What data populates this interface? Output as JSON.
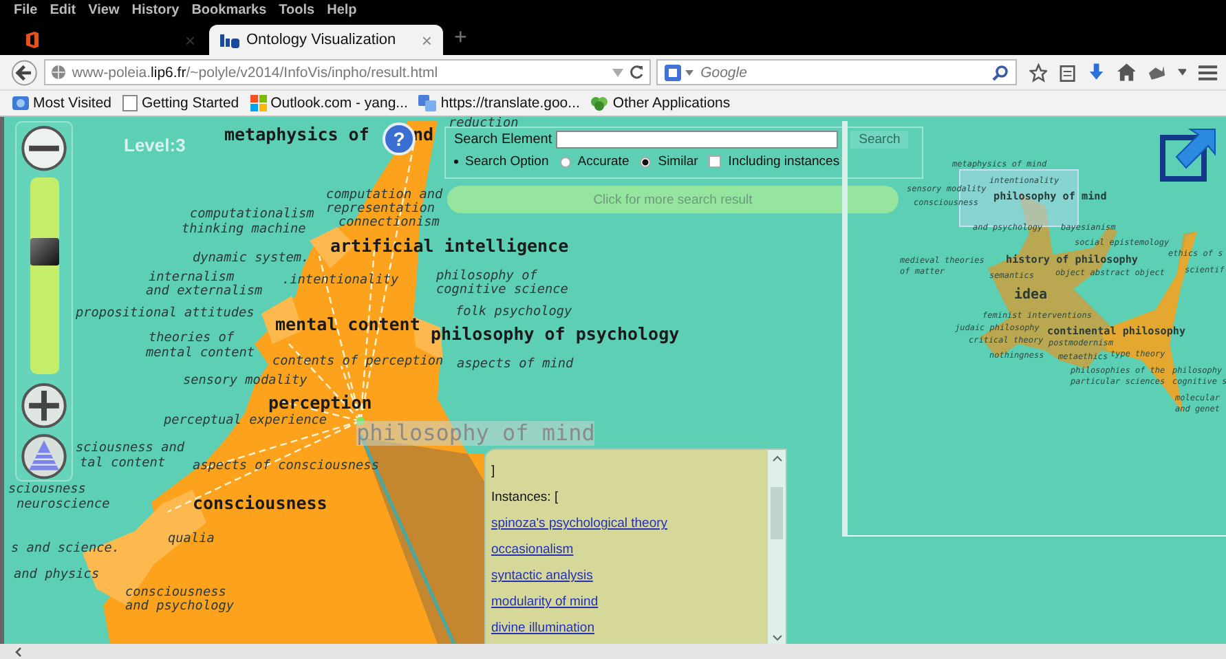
{
  "menu_bar": [
    "File",
    "Edit",
    "View",
    "History",
    "Bookmarks",
    "Tools",
    "Help"
  ],
  "tabs": [
    {
      "kind": "icon",
      "close": "×",
      "selected": false
    },
    {
      "kind": "page",
      "label": "Ontology Visualization",
      "close": "×",
      "selected": true
    }
  ],
  "new_tab": "+",
  "address_bar": {
    "url": "www-poleia.**lip6.fr**/~polyle/v2014/InfoVis/inpho/result.html"
  },
  "search_bar": {
    "placeholder": "Google"
  },
  "bookmarks": [
    {
      "label": "Most Visited",
      "kind": "globe"
    },
    {
      "label": "Getting Started",
      "kind": "page"
    },
    {
      "label": "Outlook.com - yang...",
      "kind": "tiles"
    },
    {
      "label": "https://translate.goo...",
      "kind": "translate"
    },
    {
      "label": "Other Applications",
      "kind": "leaf"
    }
  ],
  "visualization": {
    "level": "Level:3",
    "help_button": "?",
    "zoom_slider": {
      "level": 0.64
    },
    "labels": [
      {
        "text": "metaphysics of",
        "kind": "major"
      },
      {
        "text": "nd",
        "kind": "major"
      },
      {
        "text": "reduction",
        "kind": "minor"
      },
      {
        "text": "computation and",
        "kind": "minor"
      },
      {
        "text": "representation",
        "kind": "minor"
      },
      {
        "text": "connectionism",
        "kind": "minor"
      },
      {
        "text": "computationalism",
        "kind": "minor"
      },
      {
        "text": "thinking machine",
        "kind": "minor"
      },
      {
        "text": "artificial intelligence",
        "kind": "major"
      },
      {
        "text": "dynamic system.",
        "kind": "minor"
      },
      {
        "text": "internalism",
        "kind": "minor"
      },
      {
        "text": "and externalism",
        "kind": "minor"
      },
      {
        "text": ".intentionality",
        "kind": "minor"
      },
      {
        "text": "philosophy of",
        "kind": "minor"
      },
      {
        "text": "cognitive science",
        "kind": "minor"
      },
      {
        "text": "propositional attitudes",
        "kind": "minor"
      },
      {
        "text": "folk psychology",
        "kind": "minor"
      },
      {
        "text": "mental content",
        "kind": "major"
      },
      {
        "text": "theories of",
        "kind": "minor"
      },
      {
        "text": "philosophy of psychology",
        "kind": "major"
      },
      {
        "text": "mental content",
        "kind": "minor"
      },
      {
        "text": "contents of perception",
        "kind": "minor"
      },
      {
        "text": "aspects of mind",
        "kind": "minor"
      },
      {
        "text": "sensory modality",
        "kind": "minor"
      },
      {
        "text": "perception",
        "kind": "major"
      },
      {
        "text": "perceptual experience",
        "kind": "minor"
      },
      {
        "text": "philosophy of mind",
        "kind": "focus"
      },
      {
        "text": "sciousness and",
        "kind": "minor"
      },
      {
        "text": "tal content",
        "kind": "minor"
      },
      {
        "text": "aspects of consciousness",
        "kind": "minor"
      },
      {
        "text": "sciousness",
        "kind": "minor"
      },
      {
        "text": "neuroscience",
        "kind": "minor"
      },
      {
        "text": "consciousness",
        "kind": "major"
      },
      {
        "text": "qualia",
        "kind": "minor"
      },
      {
        "text": "s and science.",
        "kind": "minor"
      },
      {
        "text": "and physics",
        "kind": "minor"
      },
      {
        "text": "consciousness",
        "kind": "minor"
      },
      {
        "text": "and psychology",
        "kind": "minor"
      }
    ]
  },
  "search_panel": {
    "label": "Search Element",
    "button": "Search",
    "option_label": "Search Option",
    "options": [
      {
        "label": "Accurate",
        "selected": false
      },
      {
        "label": "Similar",
        "selected": true
      }
    ],
    "include_instances": {
      "label": "Including instances",
      "checked": false
    },
    "more_results": "Click for more search result"
  },
  "instances_popup": {
    "lines": [
      "]",
      "Instances: ["
    ],
    "links": [
      "spinoza's psychological theory",
      "occasionalism",
      "syntactic analysis",
      "modularity of mind",
      "divine illumination"
    ]
  },
  "minimap": {
    "labels": [
      {
        "text": "metaphysics of mind",
        "kind": "minor"
      },
      {
        "text": "intentionality",
        "kind": "minor"
      },
      {
        "text": "sensory modality",
        "kind": "minor"
      },
      {
        "text": "philosophy of mind",
        "kind": "major"
      },
      {
        "text": "consciousness",
        "kind": "minor"
      },
      {
        "text": "and psychology",
        "kind": "minor"
      },
      {
        "text": "bayesianism",
        "kind": "minor"
      },
      {
        "text": "social epistemology",
        "kind": "minor"
      },
      {
        "text": "ethics of s",
        "kind": "minor"
      },
      {
        "text": "medieval theories",
        "kind": "minor"
      },
      {
        "text": "of matter",
        "kind": "minor"
      },
      {
        "text": "history of philosophy",
        "kind": "major"
      },
      {
        "text": "semantics",
        "kind": "minor"
      },
      {
        "text": "object abstract object",
        "kind": "minor"
      },
      {
        "text": "scientif",
        "kind": "minor"
      },
      {
        "text": "idea",
        "kind": "large"
      },
      {
        "text": "feminist interventions",
        "kind": "minor"
      },
      {
        "text": "judaic philosophy",
        "kind": "minor"
      },
      {
        "text": "continental philosophy",
        "kind": "major"
      },
      {
        "text": "critical theory",
        "kind": "minor"
      },
      {
        "text": "postmodernism",
        "kind": "minor"
      },
      {
        "text": "nothingness",
        "kind": "minor"
      },
      {
        "text": "metaethics",
        "kind": "minor"
      },
      {
        "text": "type theory",
        "kind": "minor"
      },
      {
        "text": "philosophies of the",
        "kind": "minor"
      },
      {
        "text": "particular sciences",
        "kind": "minor"
      },
      {
        "text": "philosophy",
        "kind": "minor"
      },
      {
        "text": "cognitive s",
        "kind": "minor"
      },
      {
        "text": "molecular",
        "kind": "minor"
      },
      {
        "text": "and genet",
        "kind": "minor"
      }
    ]
  }
}
